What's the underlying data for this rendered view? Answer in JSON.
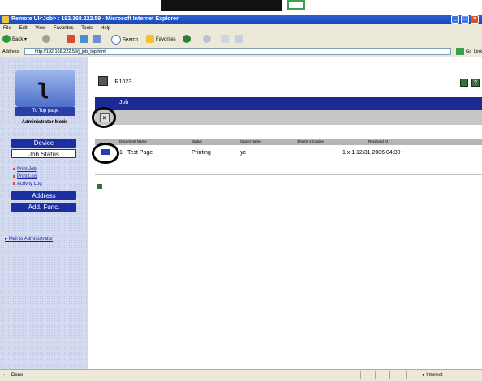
{
  "window": {
    "title": "Remote UI<Job> : 192.168.222.59 - Microsoft Internet Explorer"
  },
  "menu": [
    "File",
    "Edit",
    "View",
    "Favorites",
    "Tools",
    "Help"
  ],
  "toolbar": {
    "back": "Back",
    "search": "Search",
    "favorites": "Favorites"
  },
  "address": {
    "label": "Address",
    "url": "http://192.168.222.59/j_job_top.html",
    "go": "Go",
    "links": "Links"
  },
  "sidebar": {
    "top_page": "To Top page",
    "mode": "Administrator Mode",
    "nav": [
      "Device",
      "Job Status",
      "Address",
      "Add. Func."
    ],
    "sublinks": [
      "Print Job",
      "Print Log",
      "Activity Log"
    ],
    "mail": "Mail to Administrator"
  },
  "main": {
    "printer_name": "iR1023",
    "section_title": "Job",
    "columns": [
      "Document Name",
      "Status",
      "Owner name",
      "Sheets x Copies",
      "Received At"
    ],
    "rows": [
      {
        "num": "1",
        "name": "Test Page",
        "status": "Printing",
        "owner": "yc",
        "sheets": "1 x 1",
        "received": "12/31 2006 04:30"
      }
    ]
  },
  "status": {
    "left": "Done",
    "zone": "Internet"
  },
  "colors": {
    "title_bar": "#2356c8",
    "nav_blue": "#1c2fa0",
    "header_blue": "#1c2b93"
  }
}
